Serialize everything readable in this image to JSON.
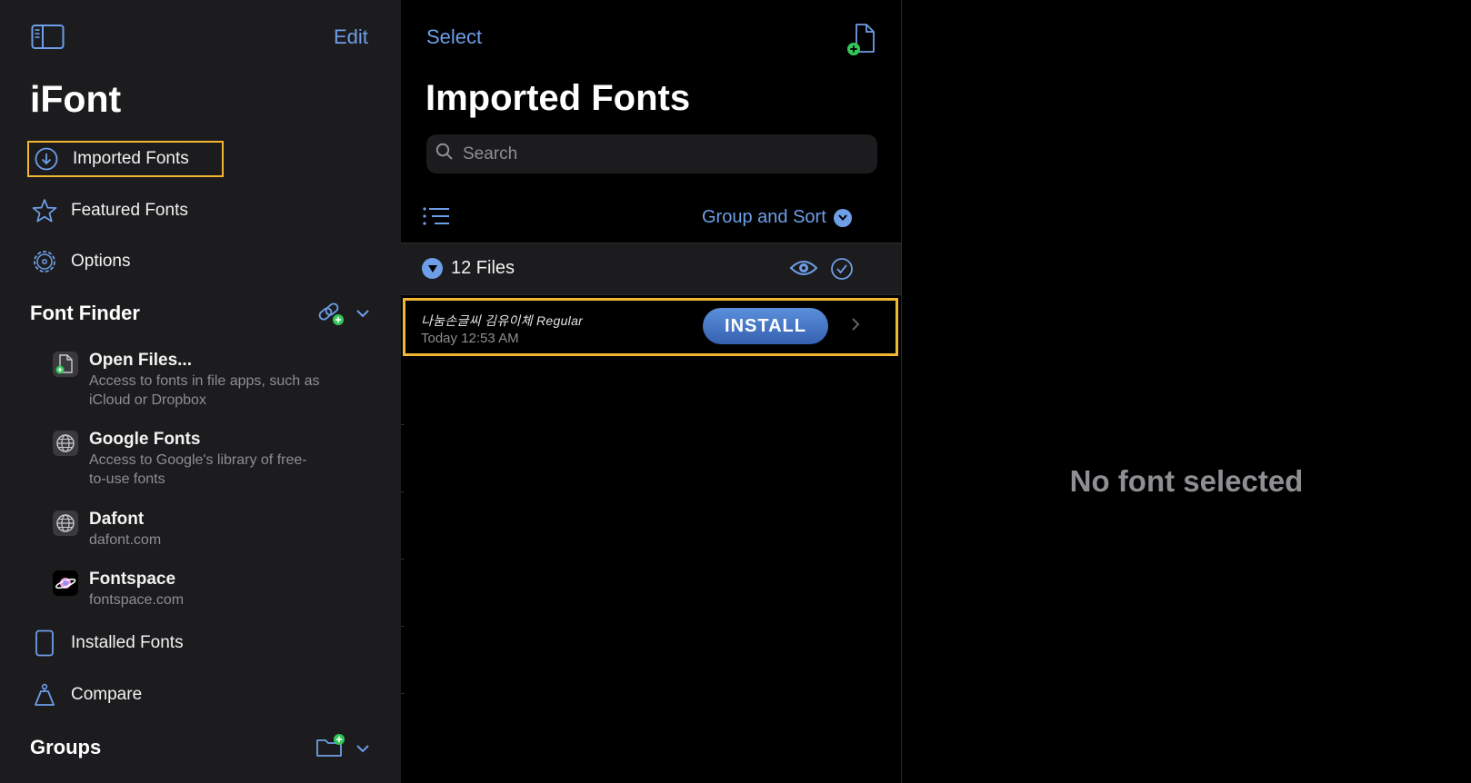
{
  "sidebar": {
    "edit_label": "Edit",
    "app_title": "iFont",
    "nav": [
      {
        "label": "Imported Fonts",
        "icon": "download-circle-icon",
        "selected": true
      },
      {
        "label": "Featured Fonts",
        "icon": "star-icon"
      },
      {
        "label": "Options",
        "icon": "gear-icon"
      }
    ],
    "font_finder": {
      "title": "Font Finder",
      "items": [
        {
          "name": "Open Files...",
          "desc": "Access to fonts in file apps, such as iCloud or Dropbox",
          "icon": "add-file-icon"
        },
        {
          "name": "Google Fonts",
          "desc": "Access to Google's library of free-to-use fonts",
          "icon": "globe-icon"
        },
        {
          "name": "Dafont",
          "desc": "dafont.com",
          "icon": "globe-icon"
        },
        {
          "name": "Fontspace",
          "desc": "fontspace.com",
          "icon": "planet-icon"
        }
      ]
    },
    "bottom_nav": [
      {
        "label": "Installed Fonts",
        "icon": "tablet-icon"
      },
      {
        "label": "Compare",
        "icon": "scale-icon"
      }
    ],
    "groups_title": "Groups"
  },
  "middle": {
    "select_label": "Select",
    "title": "Imported Fonts",
    "search_placeholder": "Search",
    "group_sort_label": "Group and Sort",
    "files_count": "12 Files",
    "font": {
      "name": "나눔손글씨 김유이체 Regular",
      "date": "Today 12:53 AM",
      "install_label": "INSTALL"
    }
  },
  "detail": {
    "empty_text": "No font selected"
  },
  "colors": {
    "accent": "#6e9ee8",
    "highlight": "#f2b632",
    "sidebar_bg": "#1c1c1e",
    "green_badge": "#34c759"
  }
}
